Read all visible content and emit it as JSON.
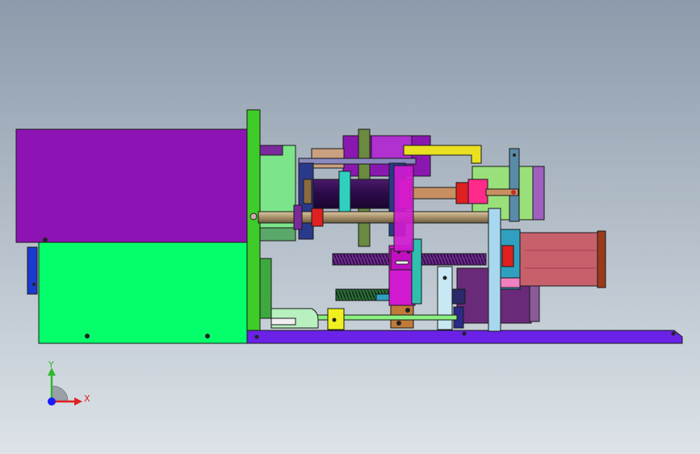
{
  "axes": {
    "y_label": "Y",
    "x_label": "X",
    "y_color": "#2fb82f",
    "x_color": "#e02020",
    "z_color": "#1a1aff"
  },
  "colors": {
    "background_top": "#8c9bab",
    "background_bottom": "#dde3e8",
    "left_box_purple": "#8e13b4",
    "left_box_green": "#05ff6b",
    "base_rail": "#6a22e6",
    "motor_pink": "#c8606c",
    "outline": "#1a1a1a"
  },
  "parts": [
    "left-purple-enclosure",
    "left-green-enclosure",
    "green-mounting-plate",
    "base-rail",
    "stepper-motor",
    "lead-screw",
    "magenta-slider-block",
    "drive-shaft"
  ]
}
